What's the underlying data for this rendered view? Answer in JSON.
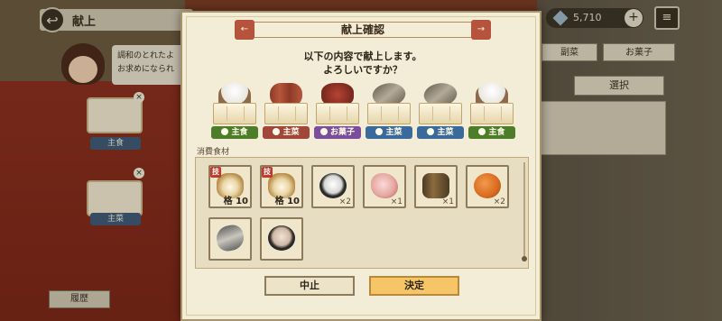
{
  "background": {
    "title": "献上",
    "npc_speech": "調和のとれたよ\nお求めになられ",
    "left_button": "履歴",
    "currency": "5,710",
    "tabs": [
      "副菜",
      "お菓子"
    ],
    "select_label": "選択",
    "pedestal_tags": [
      "主食",
      "主菜"
    ]
  },
  "dialog": {
    "title": "献上確認",
    "message_line1": "以下の内容で献上します。",
    "message_line2": "よろしいですか？",
    "offerings": [
      {
        "dish": "rice",
        "category": "主食",
        "color": "#4e7d2a"
      },
      {
        "dish": "meat",
        "category": "主菜",
        "color": "#a0473a"
      },
      {
        "dish": "sweet",
        "category": "お菓子",
        "color": "#7a4e9b"
      },
      {
        "dish": "fish",
        "category": "主菜",
        "color": "#3a6a9b"
      },
      {
        "dish": "fish",
        "category": "主菜",
        "color": "#3a6a9b"
      },
      {
        "dish": "rice",
        "category": "主食",
        "color": "#4e7d2a"
      }
    ],
    "consumed_label": "消費食材",
    "items": [
      {
        "icon": "sushi-icon",
        "badge": "技",
        "grade": "格 10",
        "qty": ""
      },
      {
        "icon": "sushi-icon",
        "badge": "技",
        "grade": "格 10",
        "qty": ""
      },
      {
        "icon": "salt-icon",
        "badge": "",
        "grade": "",
        "qty": "×2"
      },
      {
        "icon": "pork-icon",
        "badge": "",
        "grade": "",
        "qty": "×1"
      },
      {
        "icon": "barrel-icon",
        "badge": "",
        "grade": "",
        "qty": "×1"
      },
      {
        "icon": "persimmon-icon",
        "badge": "",
        "grade": "",
        "qty": "×2"
      },
      {
        "icon": "fish-icon",
        "badge": "",
        "grade": "",
        "qty": ""
      },
      {
        "icon": "flour-icon",
        "badge": "",
        "grade": "",
        "qty": ""
      }
    ],
    "cancel_label": "中止",
    "confirm_label": "決定"
  }
}
